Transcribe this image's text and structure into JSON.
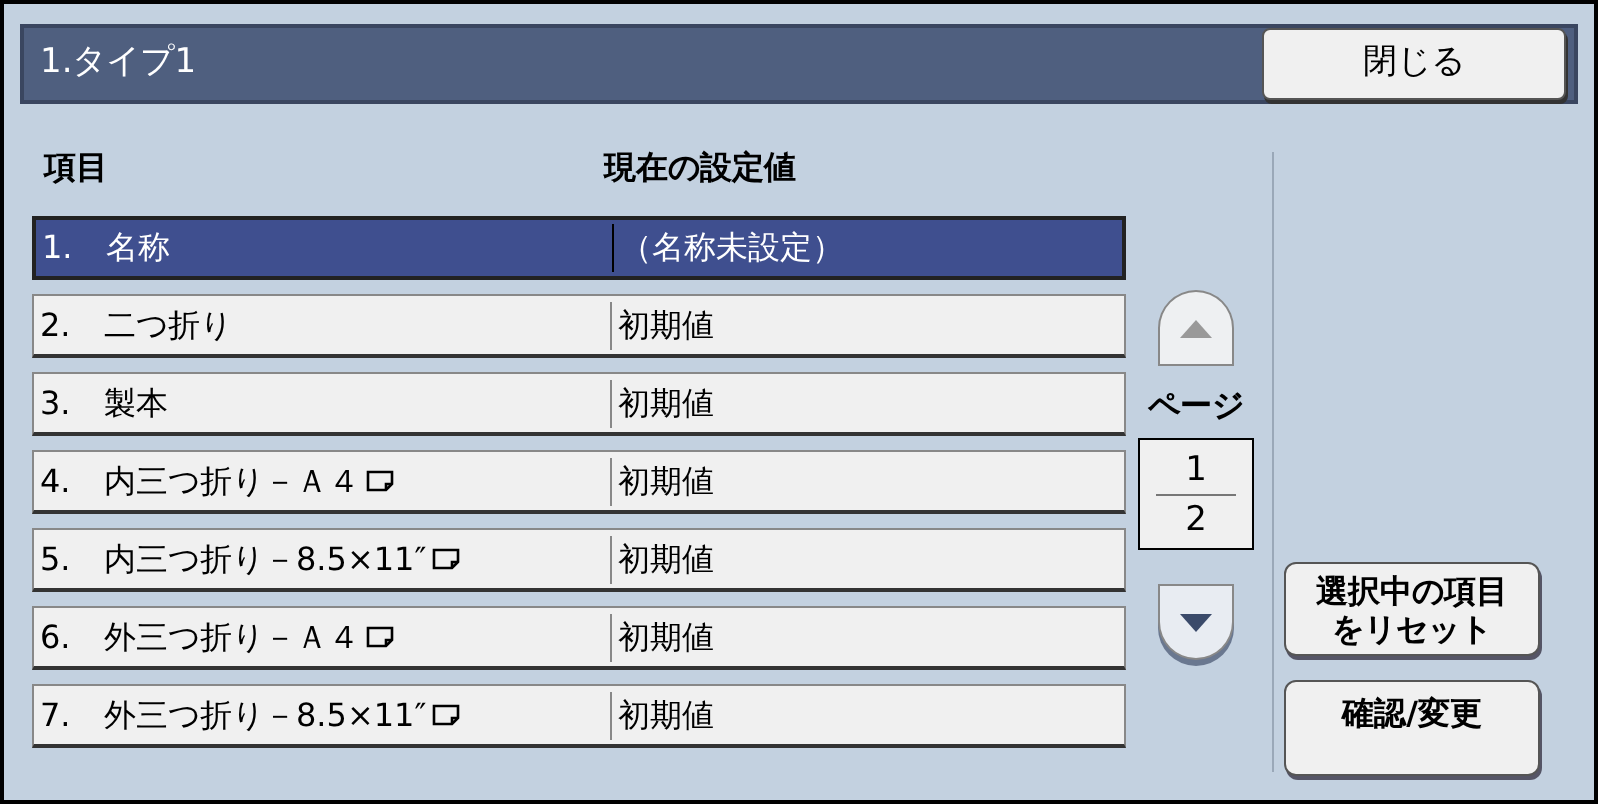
{
  "title": "1.タイプ1",
  "close_button": "閉じる",
  "columns": [
    "項目",
    "現在の設定値"
  ],
  "rows": [
    {
      "number": "1.",
      "label": "名称",
      "paper_icon": false,
      "value": "（名称未設定）",
      "selected": true
    },
    {
      "number": "2.",
      "label": "二つ折り",
      "paper_icon": false,
      "value": "初期値",
      "selected": false
    },
    {
      "number": "3.",
      "label": "製本",
      "paper_icon": false,
      "value": "初期値",
      "selected": false
    },
    {
      "number": "4.",
      "label": "内三つ折り－Ａ４",
      "paper_icon": true,
      "value": "初期値",
      "selected": false
    },
    {
      "number": "5.",
      "label": "内三つ折り－8.5×11″",
      "paper_icon": true,
      "value": "初期値",
      "selected": false
    },
    {
      "number": "6.",
      "label": "外三つ折り－Ａ４",
      "paper_icon": true,
      "value": "初期値",
      "selected": false
    },
    {
      "number": "7.",
      "label": "外三つ折り－8.5×11″",
      "paper_icon": true,
      "value": "初期値",
      "selected": false
    }
  ],
  "pager": {
    "label": "ページ",
    "current": "1",
    "total": "2",
    "up_disabled": true,
    "down_disabled": false
  },
  "reset_button": [
    "選択中の項目",
    "をリセット"
  ],
  "confirm_button": "確認/変更"
}
